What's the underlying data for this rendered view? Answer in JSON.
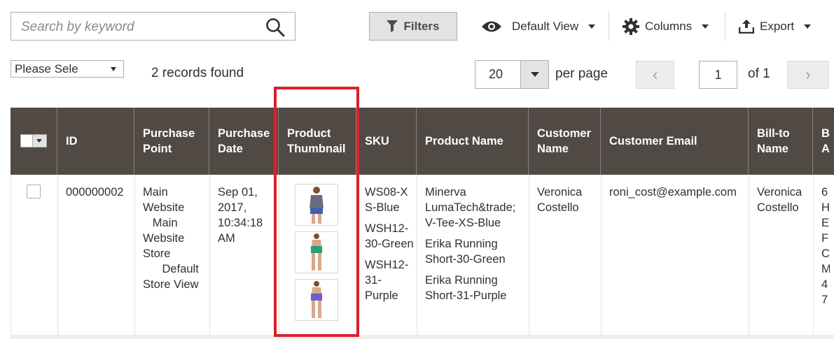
{
  "toolbar": {
    "search_placeholder": "Search by keyword",
    "filters_label": "Filters",
    "view_label": "Default View",
    "columns_label": "Columns",
    "export_label": "Export"
  },
  "actions": {
    "mass_select_label": "Please Sele",
    "records_found": "2 records found"
  },
  "pagination": {
    "per_page_value": "20",
    "per_page_label": "per page",
    "prev": "‹",
    "next": "›",
    "current_page": "1",
    "of_label": "of 1"
  },
  "grid": {
    "columns": {
      "id": "ID",
      "purchase_point": "Purchase Point",
      "purchase_date": "Purchase Date",
      "product_thumbnail": "Product Thumbnail",
      "sku": "SKU",
      "product_name": "Product Name",
      "customer_name": "Customer Name",
      "customer_email": "Customer Email",
      "bill_to_name": "Bill-to Name",
      "billing_address_partial": "B A"
    },
    "row": {
      "id": "000000002",
      "purchase_point": "Main Website\n   Main Website Store\n      Default Store View",
      "purchase_date": "Sep 01, 2017, 10:34:18 AM",
      "skus": [
        "WS08-XS-Blue",
        "WSH12-30-Green",
        "WSH12-31-Purple"
      ],
      "product_names": [
        "Minerva LumaTech&trade; V-Tee-XS-Blue",
        "Erika Running Short-30-Green",
        "Erika Running Short-31-Purple"
      ],
      "customer_name": "Veronica Costello",
      "customer_email": "roni_cost@example.com",
      "bill_to_name": "Veronica Costello",
      "billing_address_partial": "6 H E F C M 4 7"
    }
  },
  "colors": {
    "header_bg": "#514943",
    "highlight": "#d9212a"
  }
}
